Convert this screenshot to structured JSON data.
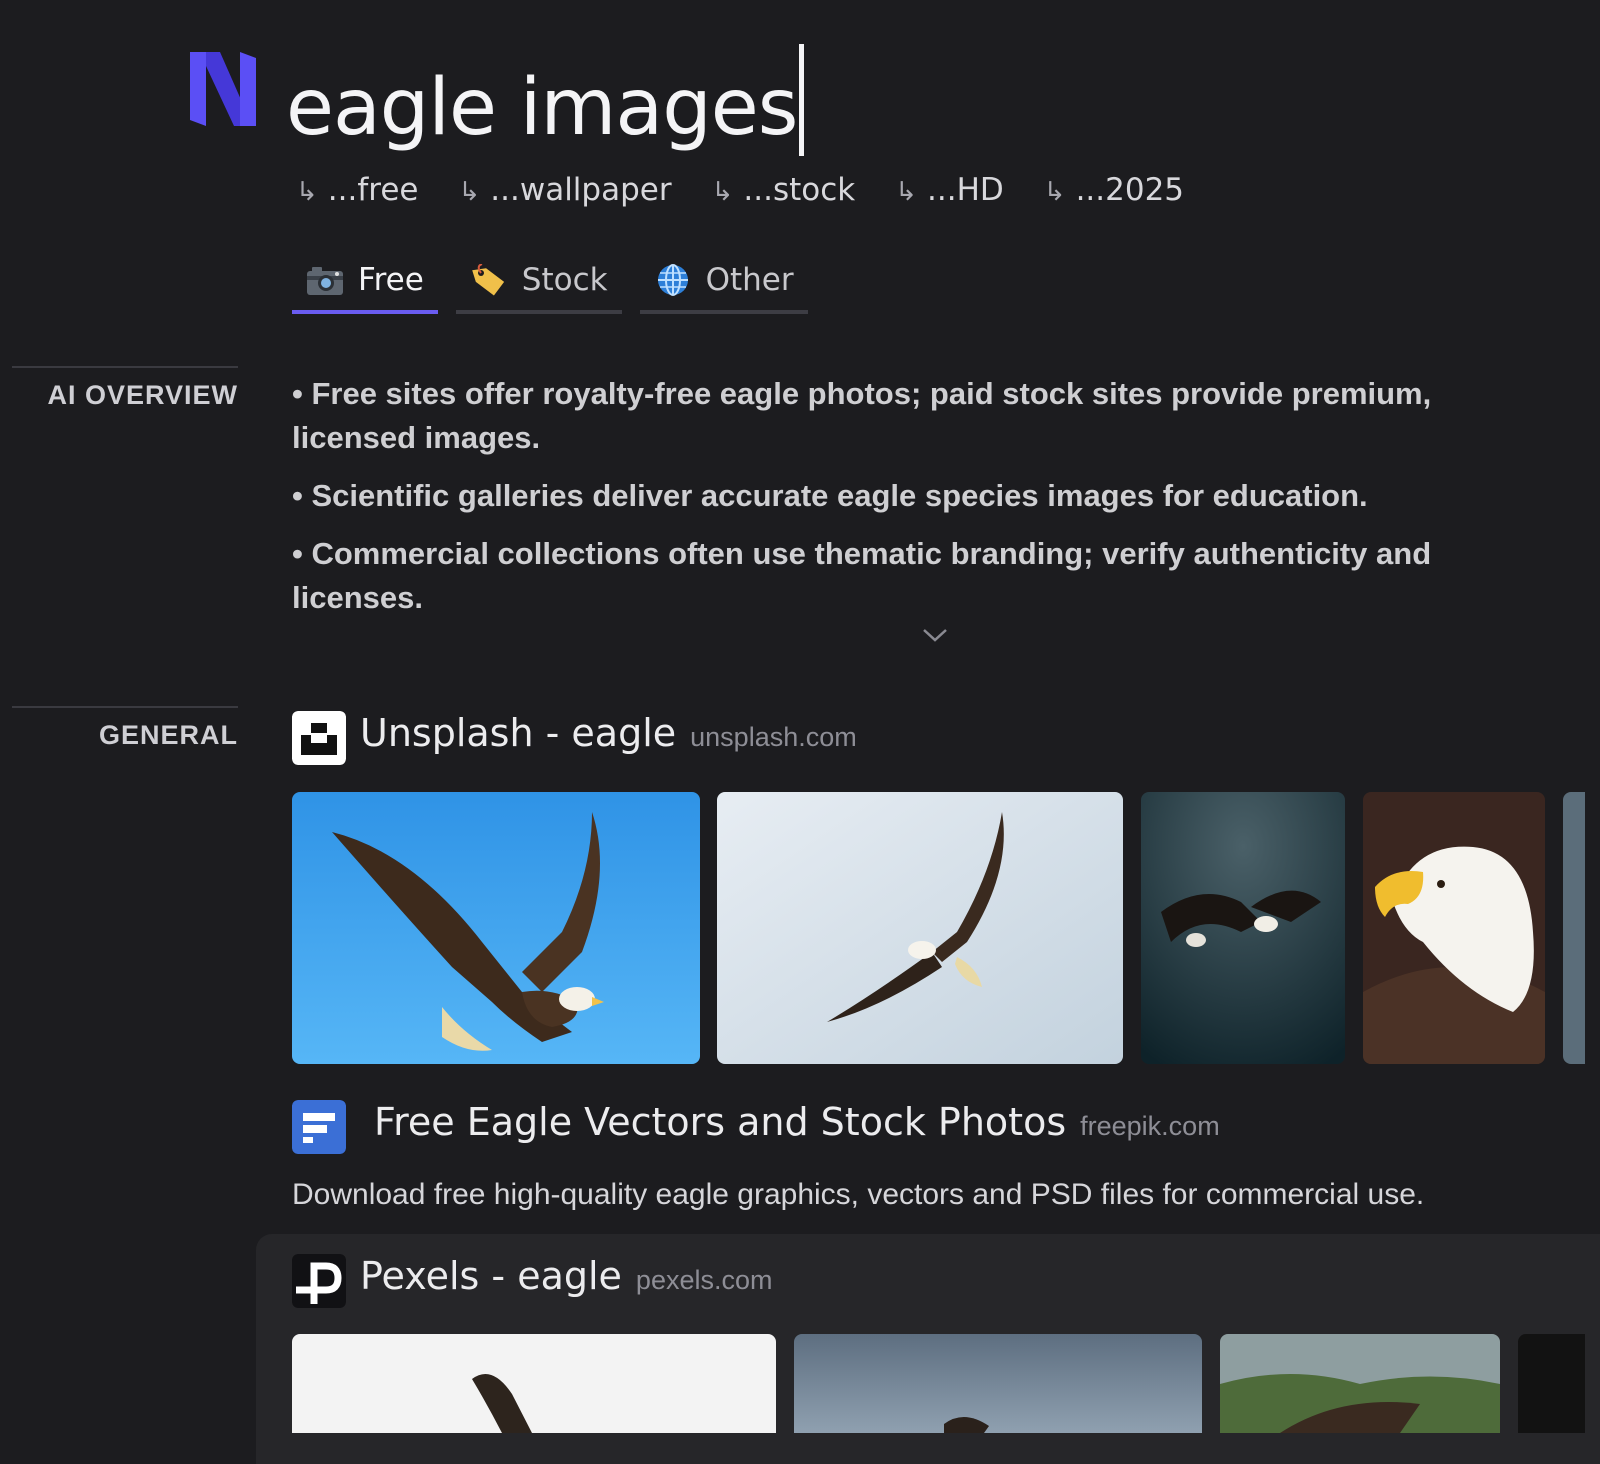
{
  "search": {
    "query": "eagle images"
  },
  "suggestions": [
    {
      "arrow": "↳",
      "label": "...free"
    },
    {
      "arrow": "↳",
      "label": "...wallpaper"
    },
    {
      "arrow": "↳",
      "label": "...stock"
    },
    {
      "arrow": "↳",
      "label": "...HD"
    },
    {
      "arrow": "↳",
      "label": "...2025"
    }
  ],
  "tabs": [
    {
      "label": "Free",
      "icon": "camera-icon",
      "active": true
    },
    {
      "label": "Stock",
      "icon": "price-tag-icon",
      "active": false
    },
    {
      "label": "Other",
      "icon": "globe-icon",
      "active": false
    }
  ],
  "sections": {
    "overview_label": "AI OVERVIEW",
    "general_label": "GENERAL"
  },
  "overview": {
    "bullets": [
      "• Free sites offer royalty-free eagle photos; paid stock sites provide premium, licensed images.",
      "• Scientific galleries deliver accurate eagle species images for education.",
      "• Commercial collections often use thematic branding; verify authenticity and licenses."
    ]
  },
  "results": [
    {
      "title": "Unsplash - eagle",
      "domain": "unsplash.com",
      "favicon": "unsplash-logo-icon"
    },
    {
      "title": "Free Eagle Vectors and Stock Photos",
      "domain": "freepik.com",
      "favicon": "freepik-logo-icon",
      "description": "Download free high-quality eagle graphics, vectors and PSD files for commercial use."
    },
    {
      "title": "Pexels - eagle",
      "domain": "pexels.com",
      "favicon": "pexels-logo-icon"
    }
  ],
  "colors": {
    "background": "#1c1c1f",
    "accent": "#6a5cf0",
    "logo": "#5b4ff5",
    "freepik": "#3b6fd6"
  }
}
